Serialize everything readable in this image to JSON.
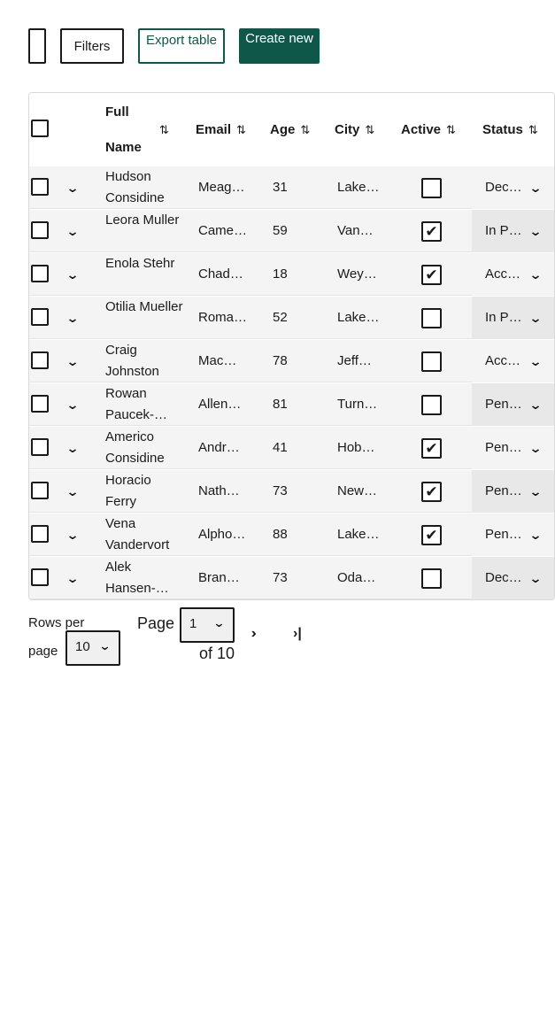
{
  "toolbar": {
    "filters_label": "Filters",
    "export_label": "Export table",
    "create_label": "Create new"
  },
  "table": {
    "columns": [
      "Full Name",
      "Email",
      "Age",
      "City",
      "Active",
      "Status"
    ],
    "rows": [
      {
        "name": "Hudson Considine",
        "email": "Meag…",
        "age": "31",
        "city": "Lake…",
        "active": false,
        "status": "Dec…"
      },
      {
        "name": "Leora Muller",
        "email": "Came…",
        "age": "59",
        "city": "Van…",
        "active": true,
        "status": "In P…"
      },
      {
        "name": "Enola Stehr",
        "email": "Chad…",
        "age": "18",
        "city": "Wey…",
        "active": true,
        "status": "Acc…"
      },
      {
        "name": "Otilia Mueller",
        "email": "Roma…",
        "age": "52",
        "city": "Lake…",
        "active": false,
        "status": "In P…"
      },
      {
        "name": "Craig Johnston",
        "email": "Mac…",
        "age": "78",
        "city": "Jeff…",
        "active": false,
        "status": "Acc…"
      },
      {
        "name": "Rowan Paucek-…",
        "email": "Allen…",
        "age": "81",
        "city": "Turn…",
        "active": false,
        "status": "Pen…"
      },
      {
        "name": "Americo Considine",
        "email": "Andre…",
        "age": "41",
        "city": "Hob…",
        "active": true,
        "status": "Pen…"
      },
      {
        "name": "Horacio Ferry",
        "email": "Nath…",
        "age": "73",
        "city": "New…",
        "active": true,
        "status": "Pen…"
      },
      {
        "name": "Vena Vandervort",
        "email": "Alpho…",
        "age": "88",
        "city": "Lake…",
        "active": true,
        "status": "Pen…"
      },
      {
        "name": "Alek Hansen-…",
        "email": "Brand…",
        "age": "73",
        "city": "Oda…",
        "active": false,
        "status": "Dec…"
      }
    ]
  },
  "pagination": {
    "rows_per_page_label": "Rows per page",
    "rows_per_page_value": "10",
    "page_label": "Page",
    "page_value": "1",
    "of_label": "of 10"
  },
  "icons": {
    "sort": "sort-arrows-icon",
    "expand": "chevron-down-icon",
    "check": "checkmark-icon",
    "next": "chevron-right-icon",
    "last": "last-page-icon"
  },
  "colors": {
    "accent": "#0f5849"
  }
}
